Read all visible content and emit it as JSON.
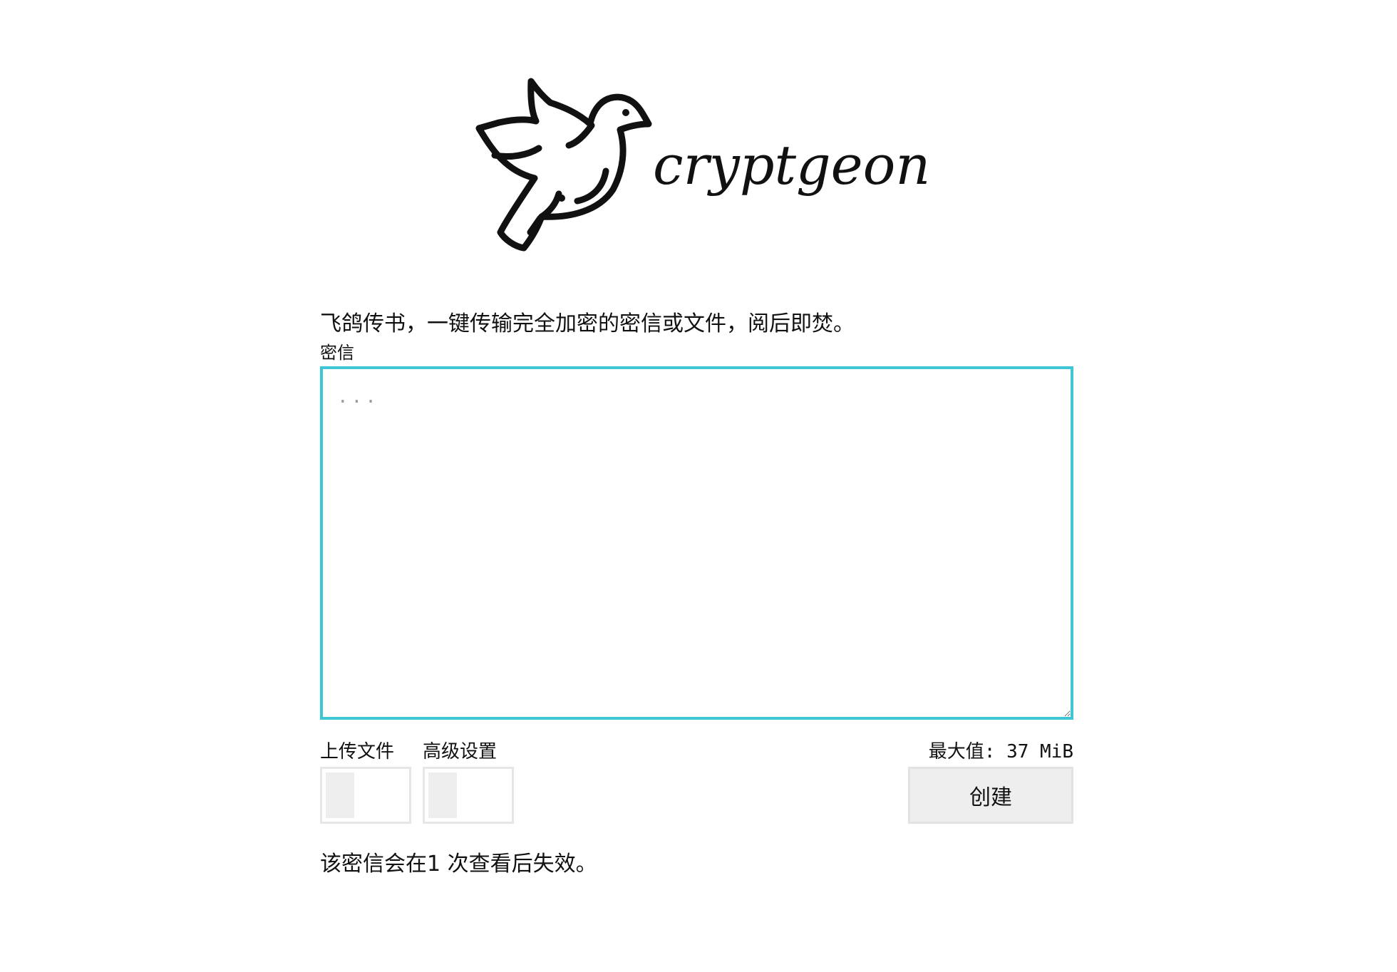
{
  "brand": {
    "name": "cryptgeon",
    "logo_icon": "dove-icon"
  },
  "intro": "飞鸽传书，一键传输完全加密的密信或文件，阅后即焚。",
  "note": {
    "label": "密信",
    "placeholder": "...",
    "value": ""
  },
  "options": {
    "upload_file_label": "上传文件",
    "advanced_label": "高级设置",
    "upload_file_on": false,
    "advanced_on": false
  },
  "limits": {
    "max_size": "最大值: 37 MiB"
  },
  "actions": {
    "create_label": "创建"
  },
  "footer": {
    "expiry_text": "该密信会在1 次查看后失效。"
  },
  "colors": {
    "accent": "#3ec6d6",
    "button_bg": "#eeeeee",
    "text": "#111111"
  }
}
